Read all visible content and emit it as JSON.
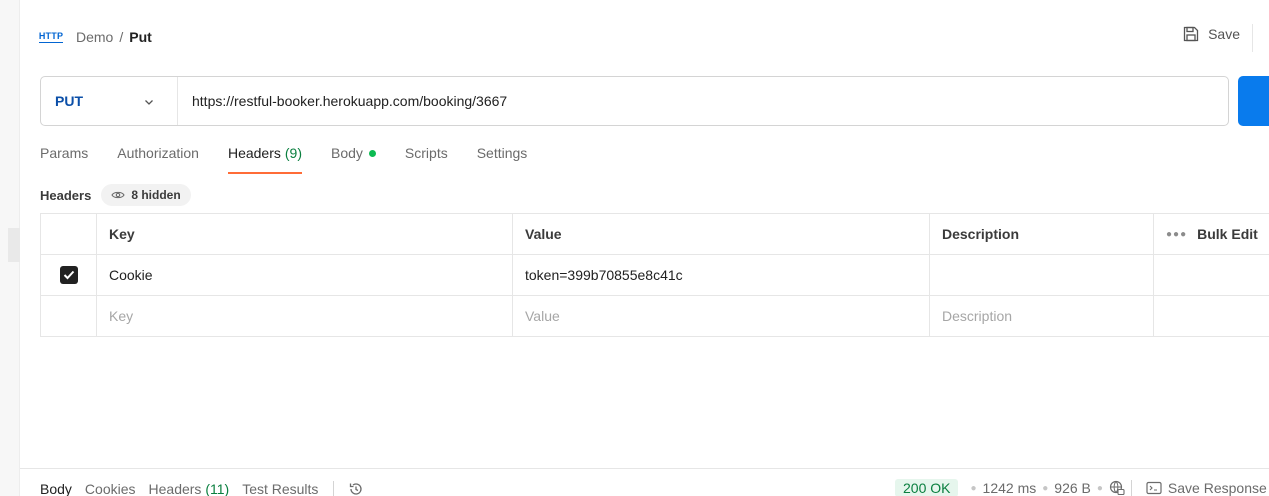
{
  "header": {
    "icon_text": "HTTP",
    "breadcrumb_parent": "Demo",
    "breadcrumb_separator": "/",
    "breadcrumb_current": "Put",
    "save_label": "Save"
  },
  "request": {
    "method": "PUT",
    "url": "https://restful-booker.herokuapp.com/booking/3667"
  },
  "tabs": [
    {
      "label": "Params"
    },
    {
      "label": "Authorization"
    },
    {
      "label": "Headers",
      "count": "(9)",
      "active": true
    },
    {
      "label": "Body",
      "has_dot": true
    },
    {
      "label": "Scripts"
    },
    {
      "label": "Settings"
    }
  ],
  "headers_section": {
    "label": "Headers",
    "hidden_label": "8 hidden"
  },
  "table": {
    "columns": {
      "key": "Key",
      "value": "Value",
      "description": "Description",
      "bulk_edit": "Bulk Edit"
    },
    "rows": [
      {
        "checked": true,
        "key": "Cookie",
        "value": "token=399b70855e8c41c",
        "description": ""
      }
    ],
    "placeholders": {
      "key": "Key",
      "value": "Value",
      "description": "Description"
    }
  },
  "response_bar": {
    "tabs": [
      {
        "label": "Body",
        "active": true
      },
      {
        "label": "Cookies"
      },
      {
        "label": "Headers",
        "count": "(11)"
      },
      {
        "label": "Test Results"
      }
    ],
    "status": "200 OK",
    "time": "1242 ms",
    "size": "926 B",
    "save_label": "Save Response"
  },
  "colors": {
    "accent_orange": "#ff6c37",
    "method_blue": "#0b4fa8",
    "send_blue": "#097bed",
    "success_green": "#0a7f3f"
  }
}
